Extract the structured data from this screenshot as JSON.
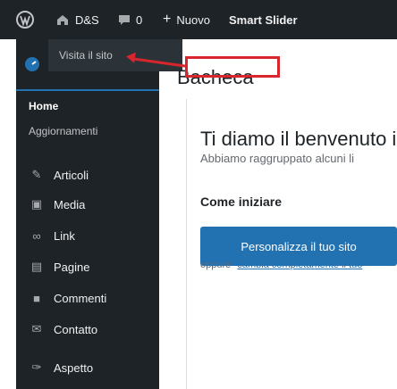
{
  "admin_bar": {
    "site_name": "D&S",
    "comments_count": "0",
    "new_label": "Nuovo",
    "slider_label": "Smart Slider"
  },
  "dropdown": {
    "visit_site_label": "Visita il sito"
  },
  "sidebar": {
    "home_label": "Home",
    "updates_label": "Aggiornamenti",
    "items": [
      {
        "label": "Articoli",
        "icon": "pin-icon"
      },
      {
        "label": "Media",
        "icon": "media-icon"
      },
      {
        "label": "Link",
        "icon": "link-icon"
      },
      {
        "label": "Pagine",
        "icon": "pages-icon"
      },
      {
        "label": "Commenti",
        "icon": "comment-icon"
      },
      {
        "label": "Contatto",
        "icon": "mail-icon"
      },
      {
        "label": "Aspetto",
        "icon": "brush-icon"
      }
    ]
  },
  "main": {
    "page_title": "Bacheca",
    "welcome_title": "Ti diamo il benvenuto in",
    "welcome_subtext": "Abbiamo raggruppato alcuni li",
    "getting_started": "Come iniziare",
    "customize_button": "Personalizza il tuo sito",
    "or_text": "oppure",
    "change_theme_link": "cambia completamente il tuo"
  },
  "colors": {
    "admin_bg": "#1d2327",
    "accent": "#2271b1",
    "annotation": "#d7262d"
  }
}
